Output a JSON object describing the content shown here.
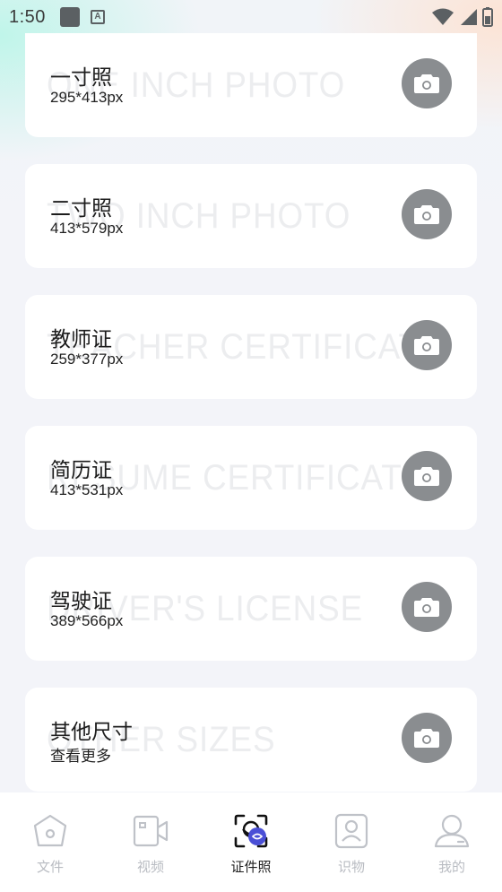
{
  "status": {
    "time": "1:50"
  },
  "cards": [
    {
      "title": "一寸照",
      "size": "295*413px",
      "ghost": "ONE INCH PHOTO"
    },
    {
      "title": "二寸照",
      "size": "413*579px",
      "ghost": "TWO INCH PHOTO"
    },
    {
      "title": "教师证",
      "size": "259*377px",
      "ghost": "TEACHER CERTIFICATE"
    },
    {
      "title": "简历证",
      "size": "413*531px",
      "ghost": "RESUME CERTIFICATE"
    },
    {
      "title": "驾驶证",
      "size": "389*566px",
      "ghost": "DRIVER'S LICENSE"
    },
    {
      "title": "其他尺寸",
      "size": "查看更多",
      "ghost": "OTHER SIZES"
    }
  ],
  "tabs": [
    {
      "label": "文件",
      "icon": "home-icon"
    },
    {
      "label": "视频",
      "icon": "video-icon"
    },
    {
      "label": "证件照",
      "icon": "id-photo-icon",
      "active": true
    },
    {
      "label": "识物",
      "icon": "contact-icon"
    },
    {
      "label": "我的",
      "icon": "profile-icon"
    }
  ],
  "colors": {
    "accent": "#4a4fd6",
    "icon_gray": "#8a8d90",
    "inactive": "#b9bcc2"
  }
}
